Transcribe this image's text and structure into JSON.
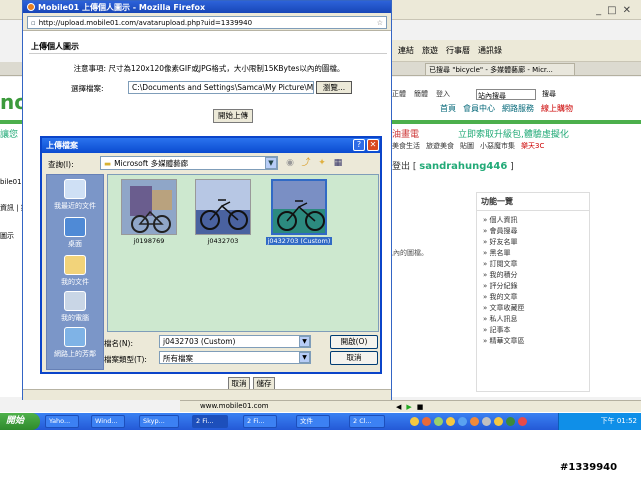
{
  "popup": {
    "title": "Mobile01 上傳個人圖示 - Mozilla Firefox",
    "url": "http://upload.mobile01.com/avatarupload.php?uid=1339940",
    "heading": "上傳個人圖示",
    "notice": "注意事項: 尺寸為120x120像素GIF或JPG格式，大小限制15KBytes以內的圖檔。",
    "select_label": "選擇檔案:",
    "file_path": "C:\\Documents and Settings\\Samca\\My Picture\\Microsoft",
    "browse_label": "瀏覽...",
    "upload_label": "開始上傳",
    "cancel_label": "取消",
    "save_label": "儲存"
  },
  "dialog": {
    "title": "上傳檔案",
    "lookin_label": "查詢(I):",
    "lookin_value": "Microsoft 多媒體藝廊",
    "places": [
      "我最近的文件",
      "桌面",
      "我的文件",
      "我的電腦",
      "網路上的芳鄰"
    ],
    "files": [
      {
        "name": "j0198769"
      },
      {
        "name": "j0432703"
      },
      {
        "name": "j0432703 (Custom)"
      }
    ],
    "filename_label": "檔名(N):",
    "filename_value": "j0432703 (Custom)",
    "filetype_label": "檔案類型(T):",
    "filetype_value": "所有檔案",
    "open_label": "開啟(O)",
    "cancel_label": "取消"
  },
  "background": {
    "toolbar_items": [
      "連結",
      "旅遊",
      "行事曆",
      "通訊錄"
    ],
    "tab_label": "已搜尋 \"bicycle\" - 多媒體藝廊 - Micr...",
    "login_items": [
      "正體",
      "簡體",
      "登入",
      "站內搜尋"
    ],
    "search_btn": "搜尋",
    "nav_items": [
      "首頁",
      "會員中心",
      "網路服務",
      "線上購物"
    ],
    "banner_left": "讓您",
    "banner_right1": "油畫電",
    "banner_right2": "立即索取升級包,體驗虛擬化",
    "links_row": [
      "美食生活",
      "旅遊美食",
      "貼圖",
      "小惡魔市集",
      "樂天3C"
    ],
    "user_prefix": "登出 [",
    "username": "sandrahung446",
    "user_suffix": "]",
    "site_logo": "no",
    "left_strip": [
      "bile01",
      "資訊 | 提",
      "圖示"
    ],
    "note": "以內的圖檔。",
    "status_url": "www.mobile01.com",
    "sidebar_title": "功能一覽",
    "sidebar_items": [
      "個人資訊",
      "會員搜尋",
      "好友名單",
      "黑名單",
      "訂閱文章",
      "我的積分",
      "評分紀錄",
      "我的文章",
      "文章收藏匣",
      "私人訊息",
      "記事本",
      "精華文章區"
    ]
  },
  "taskbar": {
    "start": "開始",
    "tasks": [
      "Yaho...",
      "Wind...",
      "Skyp...",
      "2 Fi...",
      "2 Fi...",
      "文件",
      "2 Cl..."
    ],
    "clock": "下午 01:52"
  },
  "watermark": "#1339940"
}
